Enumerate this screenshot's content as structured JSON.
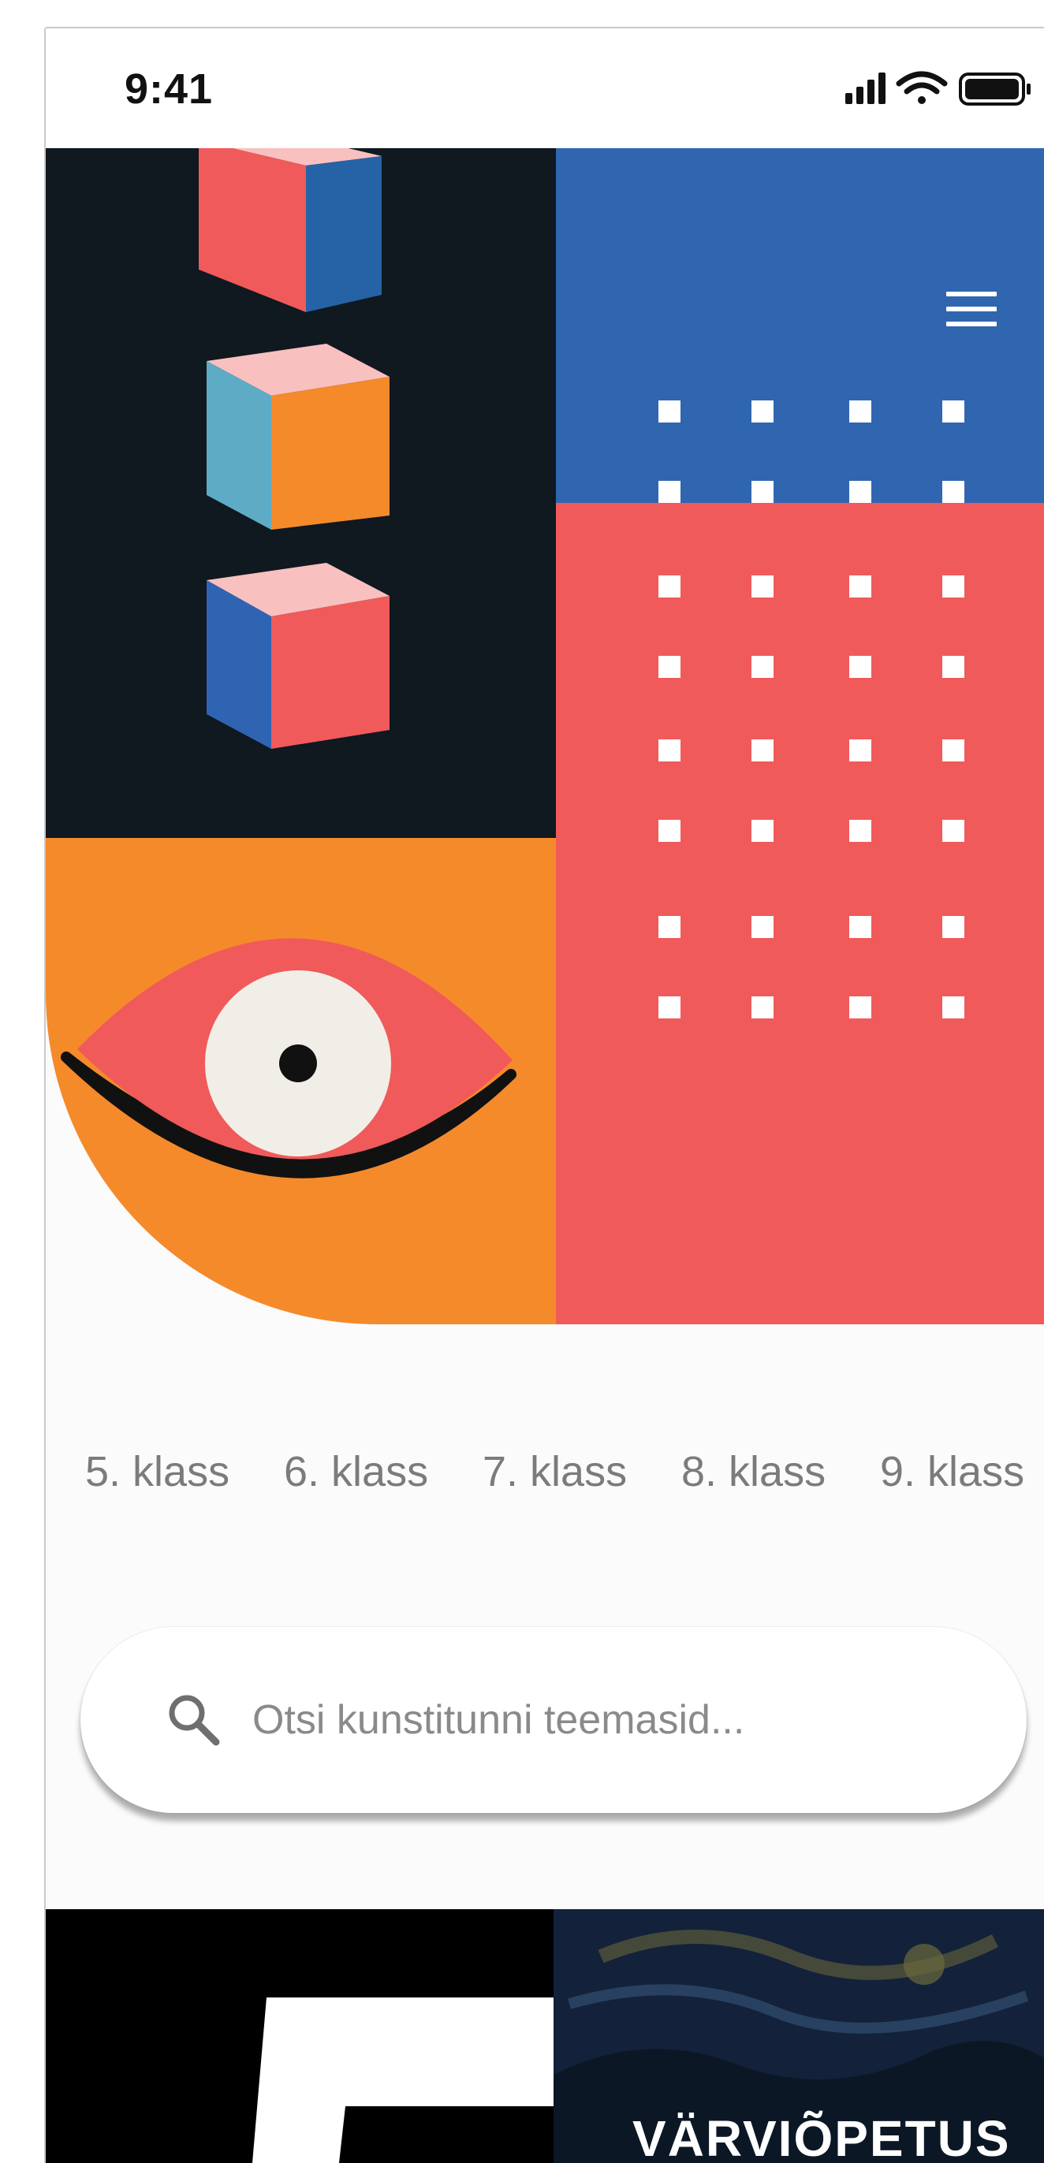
{
  "status_bar": {
    "time": "9:41"
  },
  "header": {
    "menu_icon": "hamburger-menu-icon"
  },
  "colors": {
    "dark": "#101820",
    "blue": "#3066b0",
    "red": "#f05a5a",
    "orange": "#f58a2b",
    "pink": "#f9c0c0",
    "cyan": "#5eabc6"
  },
  "grades": [
    {
      "label": "5. klass"
    },
    {
      "label": "6. klass"
    },
    {
      "label": "7. klass"
    },
    {
      "label": "8. klass"
    },
    {
      "label": "9. klass"
    }
  ],
  "search": {
    "placeholder": "Otsi kunstitunni teemasid...",
    "icon": "search-icon"
  },
  "feature": {
    "title": "VÄRVIÕPETUS"
  }
}
